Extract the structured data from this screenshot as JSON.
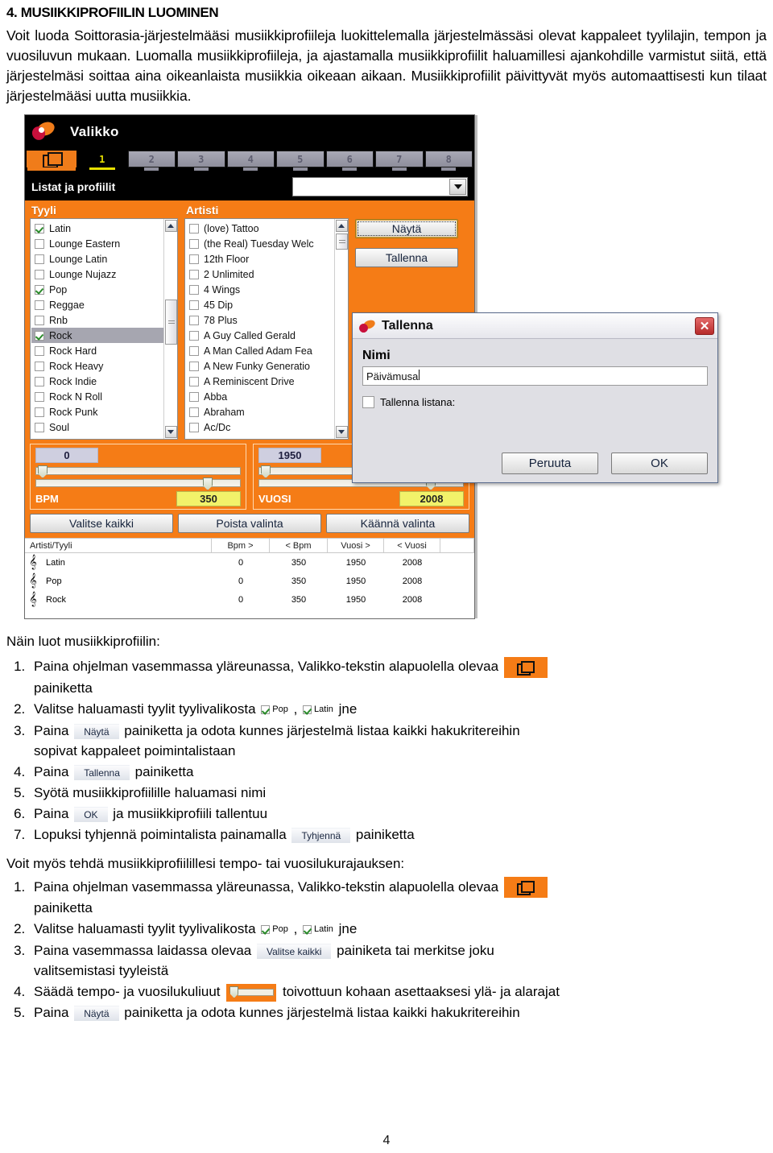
{
  "document": {
    "title": "4. MUSIIKKIPROFIILIN LUOMINEN",
    "intro": "Voit luoda Soittorasia-järjestelmääsi musiikkiprofiileja luokittelemalla järjestelmässäsi olevat kappaleet tyylilajin, tempon ja vuosiluvun mukaan. Luomalla musiikkiprofiileja, ja ajastamalla musiikkiprofiilit haluamillesi ajankohdille varmistut siitä, että järjestelmäsi soittaa aina oikeanlaista musiikkia oikeaan aikaan. Musiikkiprofiilit päivittyvät myös automaattisesti kun tilaat järjestelmääsi uutta musiikkia.",
    "page_number": "4"
  },
  "colors": {
    "brand_orange": "#F57C16",
    "brand_red": "#C8103C",
    "accent_yellow": "#f2f26a",
    "header_black": "#000000"
  },
  "app": {
    "header": {
      "title": "Valikko",
      "logo_icon": "soittorasia-logo-icon"
    },
    "tabs": [
      {
        "label": "",
        "icon": "folder-icon",
        "state": "selected"
      },
      {
        "label": "1",
        "state": "active"
      },
      {
        "label": "2",
        "state": "normal"
      },
      {
        "label": "3",
        "state": "normal"
      },
      {
        "label": "4",
        "state": "normal"
      },
      {
        "label": "5",
        "state": "normal"
      },
      {
        "label": "6",
        "state": "normal"
      },
      {
        "label": "7",
        "state": "normal"
      },
      {
        "label": "8",
        "state": "normal"
      }
    ],
    "lists_bar": {
      "label": "Listat ja profiilit",
      "combo_value": "",
      "combo_icon": "chevron-down-icon"
    },
    "style_panel": {
      "heading": "Tyyli",
      "items": [
        {
          "label": "Latin",
          "checked": true,
          "selected": false
        },
        {
          "label": "Lounge Eastern",
          "checked": false,
          "selected": false
        },
        {
          "label": "Lounge Latin",
          "checked": false,
          "selected": false
        },
        {
          "label": "Lounge Nujazz",
          "checked": false,
          "selected": false
        },
        {
          "label": "Pop",
          "checked": true,
          "selected": false
        },
        {
          "label": "Reggae",
          "checked": false,
          "selected": false
        },
        {
          "label": "Rnb",
          "checked": false,
          "selected": false
        },
        {
          "label": "Rock",
          "checked": true,
          "selected": true
        },
        {
          "label": "Rock Hard",
          "checked": false,
          "selected": false
        },
        {
          "label": "Rock Heavy",
          "checked": false,
          "selected": false
        },
        {
          "label": "Rock Indie",
          "checked": false,
          "selected": false
        },
        {
          "label": "Rock N Roll",
          "checked": false,
          "selected": false
        },
        {
          "label": "Rock Punk",
          "checked": false,
          "selected": false
        },
        {
          "label": "Soul",
          "checked": false,
          "selected": false
        }
      ]
    },
    "artist_panel": {
      "heading": "Artisti",
      "items": [
        {
          "label": "(love) Tattoo",
          "checked": false
        },
        {
          "label": "(the Real) Tuesday Welc",
          "checked": false
        },
        {
          "label": "12th Floor",
          "checked": false
        },
        {
          "label": "2 Unlimited",
          "checked": false
        },
        {
          "label": "4 Wings",
          "checked": false
        },
        {
          "label": "45 Dip",
          "checked": false
        },
        {
          "label": "78 Plus",
          "checked": false
        },
        {
          "label": "A Guy Called Gerald",
          "checked": false
        },
        {
          "label": "A Man Called Adam Fea",
          "checked": false
        },
        {
          "label": "A New Funky Generatio",
          "checked": false
        },
        {
          "label": "A Reminiscent Drive",
          "checked": false
        },
        {
          "label": "Abba",
          "checked": false
        },
        {
          "label": "Abraham",
          "checked": false
        },
        {
          "label": "Ac/Dc",
          "checked": false
        }
      ]
    },
    "side_buttons": [
      {
        "label": "Näytä",
        "focused": true
      },
      {
        "label": "Tallenna",
        "focused": false
      }
    ],
    "bpm_slider": {
      "min_value": "0",
      "name": "BPM",
      "max_value": "350"
    },
    "year_slider": {
      "min_value": "1950",
      "name": "VUOSI",
      "max_value": "2008"
    },
    "action_buttons": [
      {
        "label": "Valitse kaikki"
      },
      {
        "label": "Poista valinta"
      },
      {
        "label": "Käännä valinta"
      }
    ],
    "grid": {
      "columns": [
        "Artisti/Tyyli",
        "Bpm >",
        "< Bpm",
        "Vuosi >",
        "< Vuosi",
        ""
      ],
      "rows": [
        {
          "icon": "music-note-icon",
          "name": "Latin",
          "bpm_min": "0",
          "bpm_max": "350",
          "year_min": "1950",
          "year_max": "2008"
        },
        {
          "icon": "music-note-icon",
          "name": "Pop",
          "bpm_min": "0",
          "bpm_max": "350",
          "year_min": "1950",
          "year_max": "2008"
        },
        {
          "icon": "music-note-icon",
          "name": "Rock",
          "bpm_min": "0",
          "bpm_max": "350",
          "year_min": "1950",
          "year_max": "2008"
        }
      ]
    }
  },
  "dialog": {
    "title": "Tallenna",
    "logo_icon": "soittorasia-logo-icon",
    "close_icon": "close-icon",
    "name_label": "Nimi",
    "name_value": "Päivämusa",
    "save_as_list_label": "Tallenna listana:",
    "save_as_list_checked": false,
    "cancel_label": "Peruuta",
    "ok_label": "OK"
  },
  "howto": {
    "lead": "Näin luot musiikkiprofiilin:",
    "steps": [
      {
        "pre": "Paina ohjelman vasemmassa yläreunassa, Valikko-tekstin alapuolella olevaa",
        "widget": "folder",
        "post": "",
        "sub": "painiketta"
      },
      {
        "pre": "Valitse haluamasti tyylit tyylivalikosta",
        "widget": "checkpair",
        "check1": "Pop",
        "check2": "Latin",
        "post": "jne"
      },
      {
        "pre": "Paina",
        "widget": "button",
        "button": "Näytä",
        "post": "painiketta ja odota kunnes järjestelmä listaa kaikki hakukritereihin",
        "sub": "sopivat kappaleet poimintalistaan"
      },
      {
        "pre": "Paina",
        "widget": "button",
        "button": "Tallenna",
        "post": "painiketta"
      },
      {
        "pre": "Syötä musiikkiprofiilille haluamasi nimi",
        "widget": "none",
        "post": ""
      },
      {
        "pre": "Paina",
        "widget": "button",
        "button": "OK",
        "post": "ja musiikkiprofiili tallentuu"
      },
      {
        "pre": "Lopuksi tyhjennä poimintalista painamalla",
        "widget": "button",
        "button": "Tyhjennä",
        "post": "painiketta"
      }
    ]
  },
  "extra": {
    "lead": "Voit myös tehdä musiikkiprofiilillesi tempo- tai vuosilukurajauksen:",
    "steps": [
      {
        "pre": "Paina ohjelman vasemmassa yläreunassa, Valikko-tekstin alapuolella olevaa",
        "widget": "folder",
        "post": "",
        "sub": "painiketta"
      },
      {
        "pre": "Valitse haluamasti tyylit tyylivalikosta",
        "widget": "checkpair",
        "check1": "Pop",
        "check2": "Latin",
        "post": "jne"
      },
      {
        "pre": "Paina vasemmassa laidassa olevaa",
        "widget": "button",
        "button": "Valitse kaikki",
        "post": "painiketa tai merkitse joku",
        "sub": "valitsemistasi tyyleistä"
      },
      {
        "pre": "Säädä tempo- ja vuosilukuliuut",
        "widget": "slider",
        "post": "toivottuun kohaan asettaaksesi ylä- ja alarajat"
      },
      {
        "pre": "Paina",
        "widget": "button",
        "button": "Näytä",
        "post": "painiketta ja odota kunnes järjestelmä listaa kaikki hakukritereihin"
      }
    ]
  }
}
